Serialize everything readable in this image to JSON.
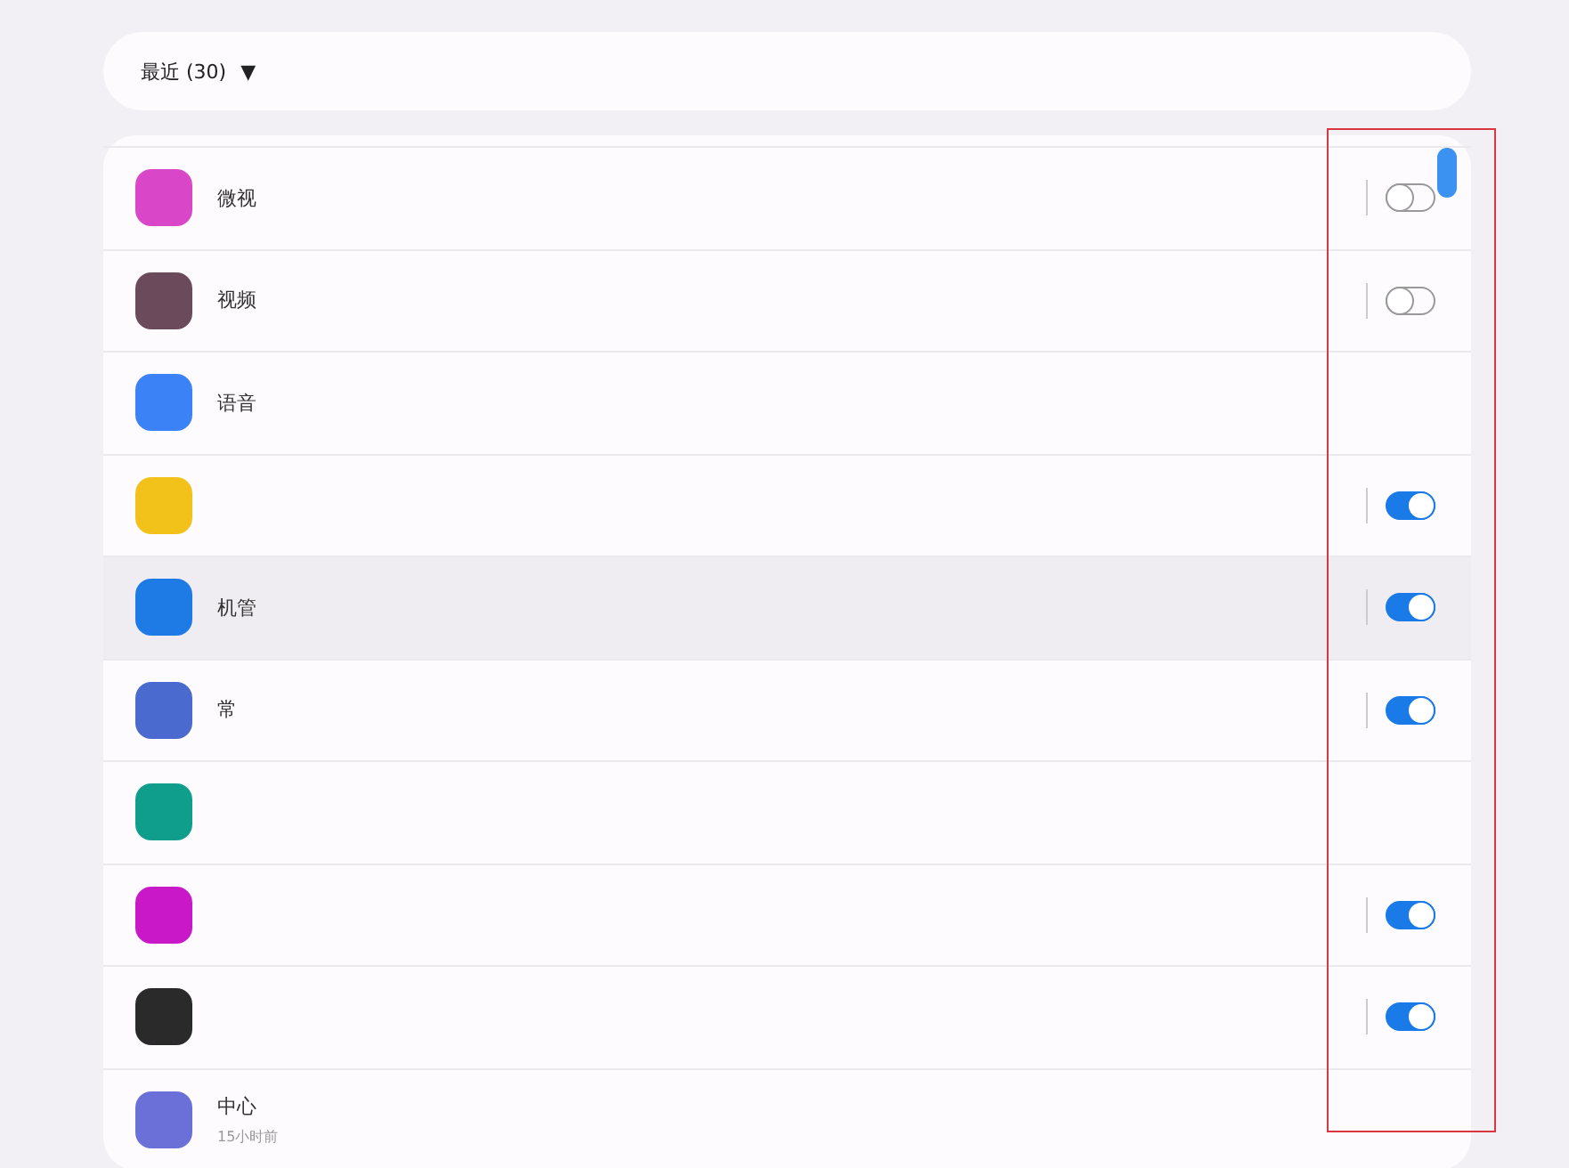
{
  "filter": {
    "label": "最近 (30)",
    "caret": "▼"
  },
  "apps": [
    {
      "name": "微视",
      "color": "#d946c8",
      "kind": "toggle",
      "on": false,
      "selected": false
    },
    {
      "name": "视频",
      "color": "#6b4a5c",
      "kind": "toggle",
      "on": false,
      "selected": false
    },
    {
      "name": "语音",
      "color": "#3b82f6",
      "kind": "plain",
      "selected": false
    },
    {
      "color": "#f2c21b",
      "kind": "toggle",
      "on": true,
      "selected": false
    },
    {
      "name": "机管",
      "color": "#1e7be6",
      "kind": "toggle",
      "on": true,
      "selected": true
    },
    {
      "name": "常",
      "color": "#4a6ad0",
      "kind": "toggle",
      "on": true,
      "selected": false
    },
    {
      "color": "#109e8c",
      "kind": "plain",
      "selected": false
    },
    {
      "color": "#c818c8",
      "kind": "toggle",
      "on": true,
      "selected": false
    },
    {
      "color": "#2a2a2a",
      "kind": "toggle",
      "on": true,
      "selected": false
    },
    {
      "name": "中心",
      "subtitle": "15小时前",
      "color": "#6a70d8",
      "kind": "plain",
      "selected": false
    }
  ]
}
